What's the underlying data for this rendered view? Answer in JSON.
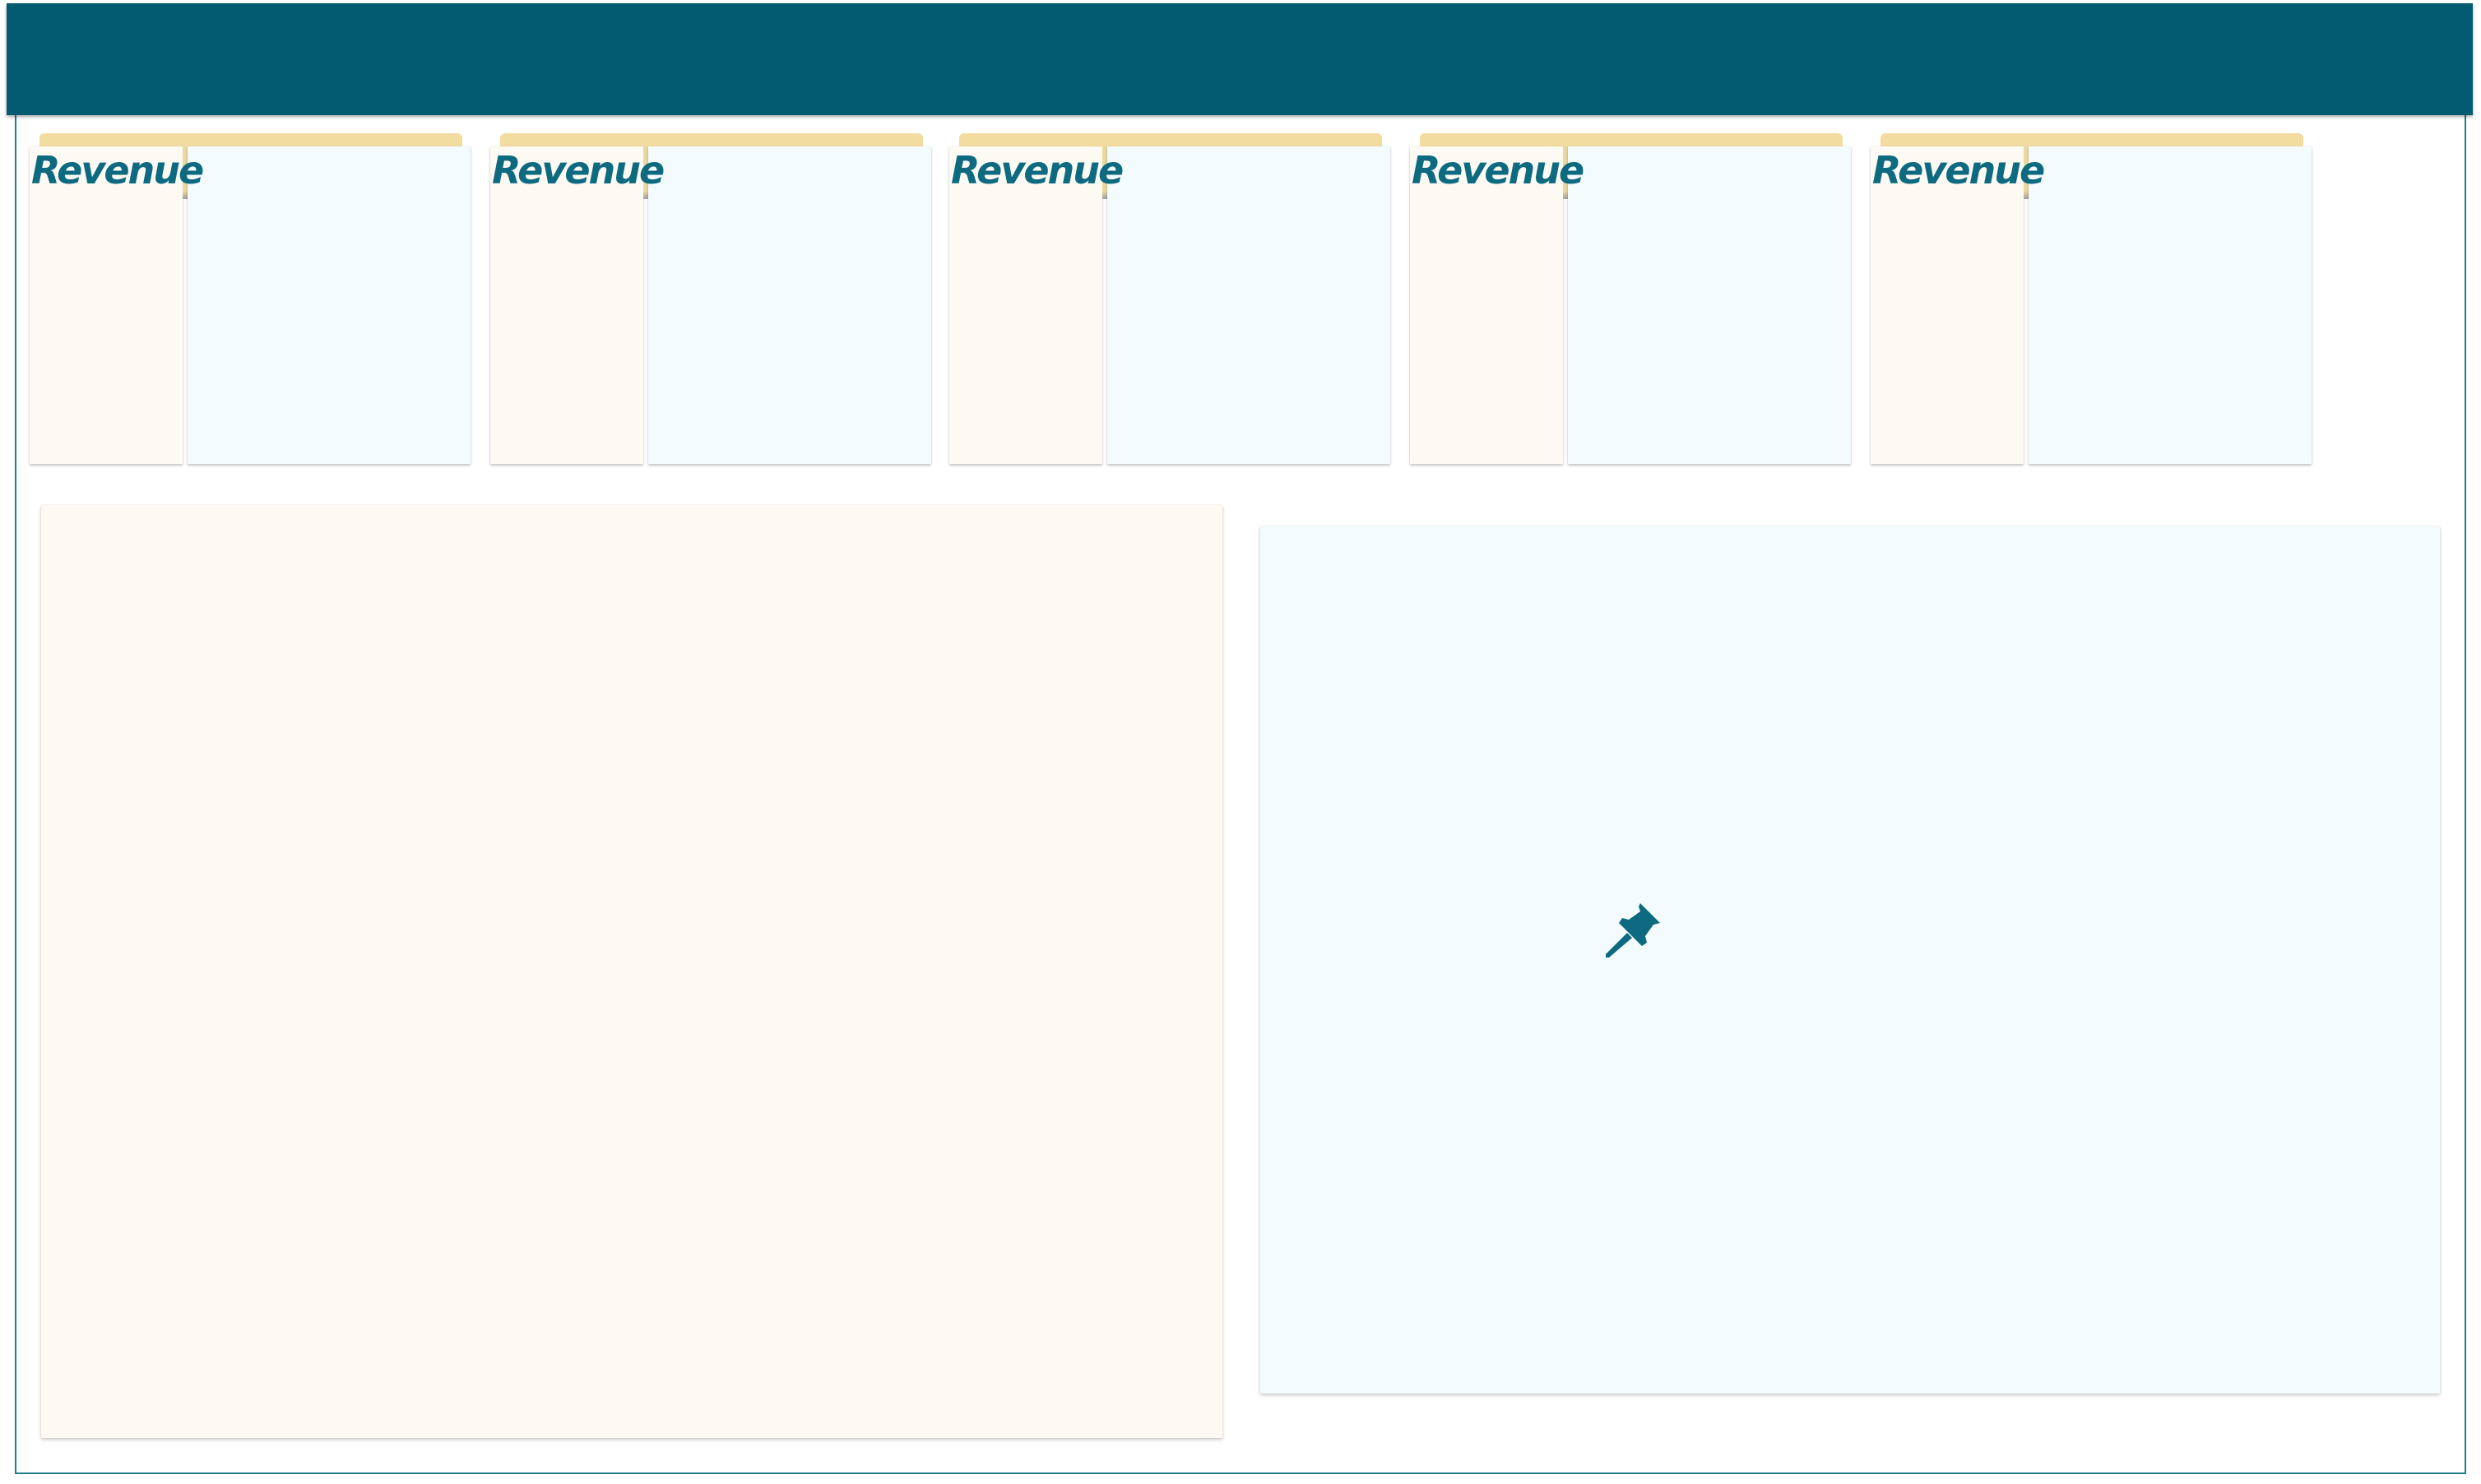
{
  "kpi_cards": [
    {
      "label": "Revenue"
    },
    {
      "label": "Revenue"
    },
    {
      "label": "Revenue"
    },
    {
      "label": "Revenue"
    },
    {
      "label": "Revenue"
    }
  ],
  "colors": {
    "header": "#035b71",
    "accent_text": "#0d6a80",
    "tab": "#f2dc9f",
    "cream_panel": "#fdfaf3",
    "blue_panel": "#f3fbfd",
    "frame_border": "#1f7d8c"
  },
  "icons": {
    "pin": "pin-icon"
  }
}
